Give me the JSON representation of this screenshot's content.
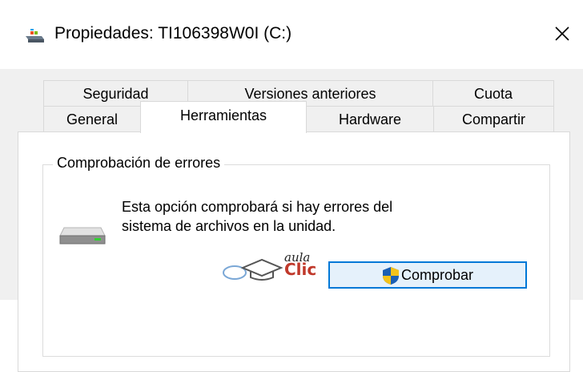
{
  "window": {
    "title": "Propiedades: TI106398W0I (C:)",
    "icon": "drive-icon",
    "close_icon": "close-icon"
  },
  "tabs": {
    "row1": [
      {
        "label": "Seguridad"
      },
      {
        "label": "Versiones anteriores"
      },
      {
        "label": "Cuota"
      }
    ],
    "row2": [
      {
        "label": "General"
      },
      {
        "label": "Herramientas",
        "active": true
      },
      {
        "label": "Hardware"
      },
      {
        "label": "Compartir"
      }
    ]
  },
  "error_check": {
    "group_label": "Comprobación de errores",
    "description_line1": "Esta opción comprobará si hay errores del",
    "description_line2": "sistema de archivos en la unidad.",
    "button_label": "Comprobar",
    "button_icon": "uac-shield-icon"
  },
  "watermark": {
    "small_text": "aula",
    "big_text": "Clic"
  },
  "colors": {
    "accent": "#0078d7",
    "button_bg": "#e5f1fb",
    "dialog_bg": "#f0f0f0",
    "watermark_red": "#c0392b"
  }
}
